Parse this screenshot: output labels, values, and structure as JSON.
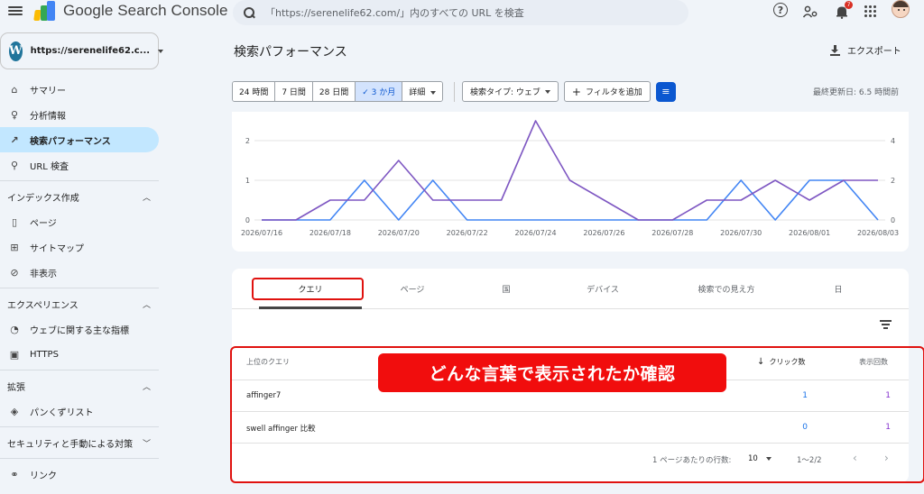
{
  "header": {
    "app_name": "Google Search Console",
    "search_placeholder": "「https://serenelife62.com/」内のすべての URL を検査",
    "notification_count": "7",
    "icons": [
      "menu-icon",
      "help-icon",
      "people-settings-icon",
      "notification-bell-icon",
      "apps-grid-icon",
      "avatar"
    ]
  },
  "sidebar": {
    "property": "https://serenelife62.c...",
    "items_top": [
      {
        "label": "サマリー",
        "icon": "home-icon",
        "glyph": "⌂"
      },
      {
        "label": "分析情報",
        "icon": "lightbulb-icon",
        "glyph": "♀"
      },
      {
        "label": "検索パフォーマンス",
        "icon": "trending-up-icon",
        "glyph": "↗",
        "active": true
      },
      {
        "label": "URL 検査",
        "icon": "search-icon",
        "glyph": "⚲"
      }
    ],
    "sections": [
      {
        "title": "インデックス作成",
        "items": [
          {
            "label": "ページ",
            "icon": "page-icon",
            "glyph": "▯"
          },
          {
            "label": "サイトマップ",
            "icon": "sitemap-icon",
            "glyph": "⊞"
          },
          {
            "label": "非表示",
            "icon": "visibility-off-icon",
            "glyph": "⊘"
          }
        ]
      },
      {
        "title": "エクスペリエンス",
        "items": [
          {
            "label": "ウェブに関する主な指標",
            "icon": "speed-icon",
            "glyph": "◔"
          },
          {
            "label": "HTTPS",
            "icon": "lock-icon",
            "glyph": "▣"
          }
        ]
      },
      {
        "title": "拡張",
        "items": [
          {
            "label": "パンくずリスト",
            "icon": "layers-icon",
            "glyph": "◈"
          }
        ]
      }
    ],
    "security_section": "セキュリティと手動による対策",
    "links_item": {
      "label": "リンク",
      "icon": "link-icon",
      "glyph": "⚭"
    }
  },
  "main": {
    "title": "検索パフォーマンス",
    "export_label": "エクスポート",
    "date_ranges": [
      "24 時間",
      "7 日間",
      "28 日間",
      "3 か月",
      "詳細"
    ],
    "selected_range": "3 か月",
    "search_type": "検索タイプ: ウェブ",
    "add_filter": "フィルタを追加",
    "last_updated": "最終更新日: 6.5 時間前"
  },
  "chart_data": {
    "type": "line",
    "x": [
      "2026/07/16",
      "2026/07/17",
      "2026/07/18",
      "2026/07/19",
      "2026/07/20",
      "2026/07/21",
      "2026/07/22",
      "2026/07/23",
      "2026/07/24",
      "2026/07/25",
      "2026/07/26",
      "2026/07/27",
      "2026/07/28",
      "2026/07/29",
      "2026/07/30",
      "2026/07/31",
      "2026/08/01",
      "2026/08/02",
      "2026/08/03"
    ],
    "x_tick_labels": [
      "2026/07/16",
      "2026/07/18",
      "2026/07/20",
      "2026/07/22",
      "2026/07/24",
      "2026/07/26",
      "2026/07/28",
      "2026/07/30",
      "2026/08/01",
      "2026/08/03"
    ],
    "y_left_ticks": [
      "0",
      "1",
      "2"
    ],
    "y_right_ticks": [
      "0",
      "2",
      "4"
    ],
    "ylim_left": [
      0,
      2
    ],
    "ylim_right": [
      0,
      4
    ],
    "series": [
      {
        "axis": "left",
        "color": "#4285f4",
        "values": [
          0,
          0,
          0,
          1,
          0,
          1,
          0,
          0,
          0,
          0,
          0,
          0,
          0,
          0,
          1,
          0,
          1,
          1,
          0
        ]
      },
      {
        "axis": "right",
        "color": "#7e57c2",
        "values": [
          0,
          0,
          1,
          1,
          3,
          1,
          1,
          1,
          5,
          2,
          1,
          0,
          0,
          1,
          1,
          2,
          1,
          2,
          2
        ]
      }
    ],
    "grid": true
  },
  "table": {
    "tabs": [
      "クエリ",
      "ページ",
      "国",
      "デバイス",
      "検索での見え方",
      "日"
    ],
    "selected_tab": "クエリ",
    "col_query": "上位のクエリ",
    "col_clicks": "クリック数",
    "col_impressions": "表示回数",
    "rows": [
      {
        "query": "affinger7",
        "clicks": "1",
        "impressions": "1"
      },
      {
        "query": "swell affinger 比較",
        "clicks": "0",
        "impressions": "1"
      }
    ],
    "rows_per_page_label": "1 ページあたりの行数:",
    "rows_per_page": "10",
    "range": "1～2/2"
  },
  "annotation": {
    "callout_text": "どんな言葉で表示されたか確認",
    "color": "#f10d0d"
  }
}
